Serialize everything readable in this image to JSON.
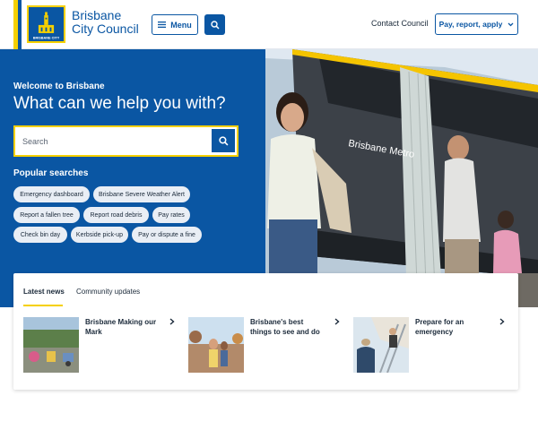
{
  "header": {
    "logo_text": "BRISBANE CITY",
    "brand_line1": "Brisbane",
    "brand_line2": "City Council",
    "menu_label": "Menu",
    "contact_label": "Contact Council",
    "pay_label": "Pay, report, apply"
  },
  "hero": {
    "welcome": "Welcome to Brisbane",
    "headline": "What can we help you with?",
    "search_placeholder": "Search",
    "popular_title": "Popular searches",
    "chips": [
      "Emergency dashboard",
      "Brisbane Severe Weather Alert",
      "Report a fallen tree",
      "Report road debris",
      "Pay rates",
      "Check bin day",
      "Kerbside pick-up",
      "Pay or dispute a fine"
    ],
    "bus_sign": "Brisbane Metro"
  },
  "news": {
    "tabs": [
      "Latest news",
      "Community updates"
    ],
    "items": [
      {
        "title": "Brisbane Making our Mark"
      },
      {
        "title": "Brisbane's best things to see and do"
      },
      {
        "title": "Prepare for an emergency"
      }
    ]
  },
  "colors": {
    "primary": "#0a56a3",
    "accent": "#f5d000",
    "chip_bg": "#e9eef5"
  }
}
